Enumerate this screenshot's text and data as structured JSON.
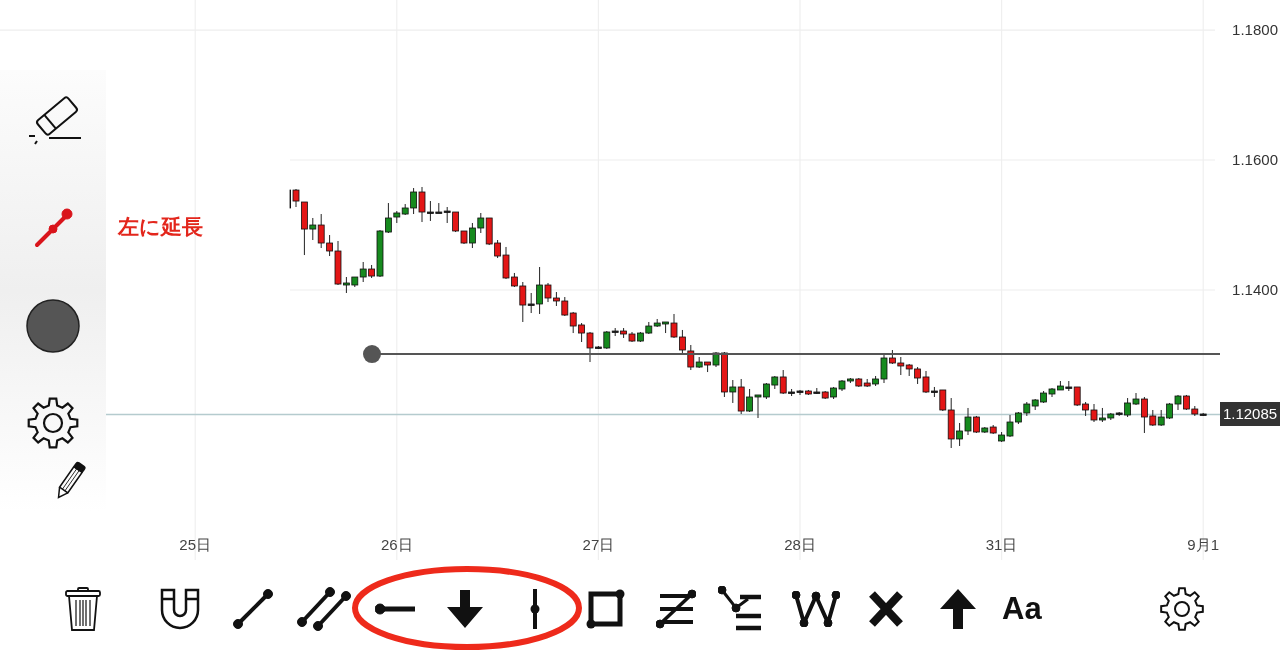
{
  "chart": {
    "chart_data": {
      "type": "candlestick",
      "grid": true,
      "categories": [
        "25日",
        null,
        null,
        null,
        null,
        null,
        null,
        null,
        null,
        null,
        null,
        null,
        null,
        null,
        null,
        null,
        null,
        null,
        null,
        null,
        null,
        null,
        null,
        null,
        "26日",
        null,
        null,
        null,
        null,
        null,
        null,
        null,
        null,
        null,
        null,
        null,
        null,
        null,
        null,
        null,
        null,
        null,
        null,
        null,
        null,
        null,
        null,
        null,
        "27日",
        null,
        null,
        null,
        null,
        null,
        null,
        null,
        null,
        null,
        null,
        null,
        null,
        null,
        null,
        null,
        null,
        null,
        null,
        null,
        null,
        null,
        null,
        null,
        "28日",
        null,
        null,
        null,
        null,
        null,
        null,
        null,
        null,
        null,
        null,
        null,
        null,
        null,
        null,
        null,
        null,
        null,
        null,
        null,
        null,
        null,
        null,
        null,
        "31日",
        null,
        null,
        null,
        null,
        null,
        null,
        null,
        null,
        null,
        null,
        null,
        null,
        null,
        null,
        null,
        null,
        null,
        null,
        null,
        null,
        null,
        null,
        null,
        "9月1"
      ],
      "ohlc": [
        null,
        null,
        null,
        null,
        null,
        null,
        null,
        null,
        null,
        null,
        null,
        [
          1.15538,
          1.15538,
          1.15262,
          1.15262
        ],
        [
          1.15538,
          1.15554,
          1.15277,
          1.15369
        ],
        [
          1.15354,
          1.15354,
          1.14538,
          1.14938
        ],
        [
          1.14938,
          1.15108,
          1.14769,
          1.15
        ],
        [
          1.15,
          1.15169,
          1.14646,
          1.14723
        ],
        [
          1.14723,
          1.14846,
          1.14523,
          1.146
        ],
        [
          1.146,
          1.14754,
          1.14077,
          1.14092
        ],
        [
          1.14077,
          1.142,
          1.13954,
          1.14108
        ],
        [
          1.14077,
          1.142,
          1.14046,
          1.142
        ],
        [
          1.142,
          1.14431,
          1.14123,
          1.14323
        ],
        [
          1.14323,
          1.14385,
          1.14185,
          1.14215
        ],
        [
          1.14215,
          1.14923,
          1.142,
          1.14908
        ],
        [
          1.14892,
          1.15338,
          1.14877,
          1.15108
        ],
        [
          1.15123,
          1.15215,
          1.15031,
          1.15185
        ],
        [
          1.15169,
          1.15323,
          1.15154,
          1.15262
        ],
        [
          1.15262,
          1.15569,
          1.15169,
          1.15508
        ],
        [
          1.15508,
          1.15585,
          1.15046,
          1.152
        ],
        [
          1.15185,
          1.15369,
          1.15062,
          1.152
        ],
        [
          1.15185,
          1.15338,
          1.15185,
          1.152
        ],
        [
          1.152,
          1.15277,
          1.15031,
          1.15215
        ],
        [
          1.152,
          1.152,
          1.14892,
          1.14908
        ],
        [
          1.14908,
          1.14908,
          1.14708,
          1.14723
        ],
        [
          1.14723,
          1.15031,
          1.14646,
          1.14954
        ],
        [
          1.14954,
          1.15185,
          1.14877,
          1.15108
        ],
        [
          1.15108,
          1.15108,
          1.14692,
          1.14708
        ],
        [
          1.14723,
          1.14769,
          1.14492,
          1.14523
        ],
        [
          1.14538,
          1.14662,
          1.14169,
          1.14185
        ],
        [
          1.142,
          1.14262,
          1.14046,
          1.14062
        ],
        [
          1.14062,
          1.14123,
          1.13508,
          1.13769
        ],
        [
          1.13769,
          1.13954,
          1.13646,
          1.13785
        ],
        [
          1.13785,
          1.14354,
          1.13631,
          1.14077
        ],
        [
          1.14077,
          1.14108,
          1.13815,
          1.13877
        ],
        [
          1.13877,
          1.13969,
          1.13754,
          1.13831
        ],
        [
          1.13831,
          1.13892,
          1.136,
          1.13615
        ],
        [
          1.13646,
          1.13662,
          1.13338,
          1.13446
        ],
        [
          1.13462,
          1.13492,
          1.132,
          1.13338
        ],
        [
          1.13338,
          1.13354,
          1.12892,
          1.13108
        ],
        [
          1.13108,
          1.13138,
          1.13092,
          1.13123
        ],
        [
          1.13108,
          1.13369,
          1.13092,
          1.13354
        ],
        [
          1.13354,
          1.13415,
          1.13292,
          1.13369
        ],
        [
          1.13369,
          1.13415,
          1.13262,
          1.13323
        ],
        [
          1.13323,
          1.13354,
          1.132,
          1.13215
        ],
        [
          1.13215,
          1.13354,
          1.132,
          1.13338
        ],
        [
          1.13338,
          1.13508,
          1.13323,
          1.13446
        ],
        [
          1.13446,
          1.13554,
          1.13431,
          1.13492
        ],
        [
          1.13477,
          1.13508,
          1.13338,
          1.13508
        ],
        [
          1.13492,
          1.13631,
          1.13262,
          1.13277
        ],
        [
          1.13277,
          1.13385,
          1.13031,
          1.13077
        ],
        [
          1.13062,
          1.13154,
          1.12769,
          1.12815
        ],
        [
          1.12815,
          1.12969,
          1.128,
          1.12892
        ],
        [
          1.12892,
          1.12892,
          1.12738,
          1.12846
        ],
        [
          1.12846,
          1.13046,
          1.12815,
          1.13031
        ],
        [
          1.13031,
          1.13046,
          1.12354,
          1.12431
        ],
        [
          1.12431,
          1.12615,
          1.12262,
          1.12508
        ],
        [
          1.12508,
          1.12631,
          1.12092,
          1.12138
        ],
        [
          1.12138,
          1.12477,
          1.12123,
          1.12354
        ],
        [
          1.12354,
          1.12385,
          1.12031,
          1.12385
        ],
        [
          1.12354,
          1.12569,
          1.12323,
          1.12554
        ],
        [
          1.12538,
          1.12677,
          1.12477,
          1.12662
        ],
        [
          1.12662,
          1.12769,
          1.124,
          1.12415
        ],
        [
          1.12415,
          1.12477,
          1.12369,
          1.12431
        ],
        [
          1.12431,
          1.12462,
          1.12385,
          1.12446
        ],
        [
          1.12446,
          1.12462,
          1.12385,
          1.124
        ],
        [
          1.12415,
          1.12492,
          1.124,
          1.12431
        ],
        [
          1.12431,
          1.12446,
          1.12323,
          1.12338
        ],
        [
          1.12354,
          1.12508,
          1.12323,
          1.12492
        ],
        [
          1.12477,
          1.12615,
          1.12446,
          1.126
        ],
        [
          1.126,
          1.12646,
          1.12569,
          1.12631
        ],
        [
          1.12631,
          1.12646,
          1.12508,
          1.12523
        ],
        [
          1.12569,
          1.12631,
          1.12508,
          1.12523
        ],
        [
          1.12554,
          1.12677,
          1.12523,
          1.12631
        ],
        [
          1.12631,
          1.13031,
          1.12569,
          1.12954
        ],
        [
          1.12954,
          1.13077,
          1.12862,
          1.12877
        ],
        [
          1.12877,
          1.12969,
          1.12692,
          1.12831
        ],
        [
          1.12846,
          1.12862,
          1.12677,
          1.12785
        ],
        [
          1.12785,
          1.12815,
          1.12554,
          1.12646
        ],
        [
          1.12662,
          1.12754,
          1.12415,
          1.12431
        ],
        [
          1.12431,
          1.12508,
          1.12354,
          1.12446
        ],
        [
          1.12462,
          1.12462,
          1.12138,
          1.12154
        ],
        [
          1.12154,
          1.12338,
          1.11569,
          1.11708
        ],
        [
          1.11708,
          1.11954,
          1.116,
          1.11831
        ],
        [
          1.11831,
          1.12185,
          1.11769,
          1.12046
        ],
        [
          1.12046,
          1.12062,
          1.118,
          1.11815
        ],
        [
          1.11815,
          1.11892,
          1.118,
          1.11877
        ],
        [
          1.11892,
          1.11923,
          1.11785,
          1.118
        ],
        [
          1.11677,
          1.11815,
          1.11662,
          1.11769
        ],
        [
          1.11754,
          1.12077,
          1.11738,
          1.11969
        ],
        [
          1.11969,
          1.12123,
          1.11938,
          1.12108
        ],
        [
          1.12108,
          1.12277,
          1.12062,
          1.12246
        ],
        [
          1.12215,
          1.12323,
          1.12154,
          1.12308
        ],
        [
          1.12277,
          1.12446,
          1.12262,
          1.12415
        ],
        [
          1.124,
          1.12492,
          1.12354,
          1.12477
        ],
        [
          1.12462,
          1.126,
          1.12462,
          1.12523
        ],
        [
          1.12492,
          1.126,
          1.12446,
          1.12508
        ],
        [
          1.12508,
          1.12508,
          1.12215,
          1.12231
        ],
        [
          1.12246,
          1.12277,
          1.12062,
          1.12154
        ],
        [
          1.12154,
          1.12246,
          1.11969,
          1.12
        ],
        [
          1.12,
          1.12185,
          1.11969,
          1.12031
        ],
        [
          1.12031,
          1.12108,
          1.12,
          1.12092
        ],
        [
          1.12092,
          1.12123,
          1.12062,
          1.12108
        ],
        [
          1.12077,
          1.12338,
          1.12046,
          1.12262
        ],
        [
          1.12246,
          1.12415,
          1.12231,
          1.12323
        ],
        [
          1.12323,
          1.12354,
          1.118,
          1.12046
        ],
        [
          1.12062,
          1.12154,
          1.11908,
          1.11923
        ],
        [
          1.11923,
          1.12154,
          1.11908,
          1.12046
        ],
        [
          1.12031,
          1.12262,
          1.12015,
          1.12246
        ],
        [
          1.12246,
          1.12385,
          1.12154,
          1.12369
        ],
        [
          1.12369,
          1.12385,
          1.12154,
          1.12169
        ],
        [
          1.12169,
          1.12215,
          1.12062,
          1.12092
        ],
        [
          1.12077,
          1.12108,
          1.12062,
          1.12092
        ]
      ],
      "ylim": [
        1.09846,
        1.18462
      ],
      "yticks": [
        {
          "value": 1.18,
          "label": "1.1800"
        },
        {
          "value": 1.16,
          "label": "1.1600"
        },
        {
          "value": 1.14,
          "label": "1.1400"
        }
      ],
      "ref_lines": [
        {
          "axis": "y",
          "value": 1.13015
        },
        {
          "axis": "y",
          "value": 1.12085,
          "label": "1.12085"
        }
      ]
    }
  },
  "side_panel": {
    "extend_left": {
      "label": "左に延長",
      "on": true
    },
    "color_swatch": {
      "color": "#555555"
    }
  },
  "toolbar": {
    "text_tool": "Aa"
  }
}
